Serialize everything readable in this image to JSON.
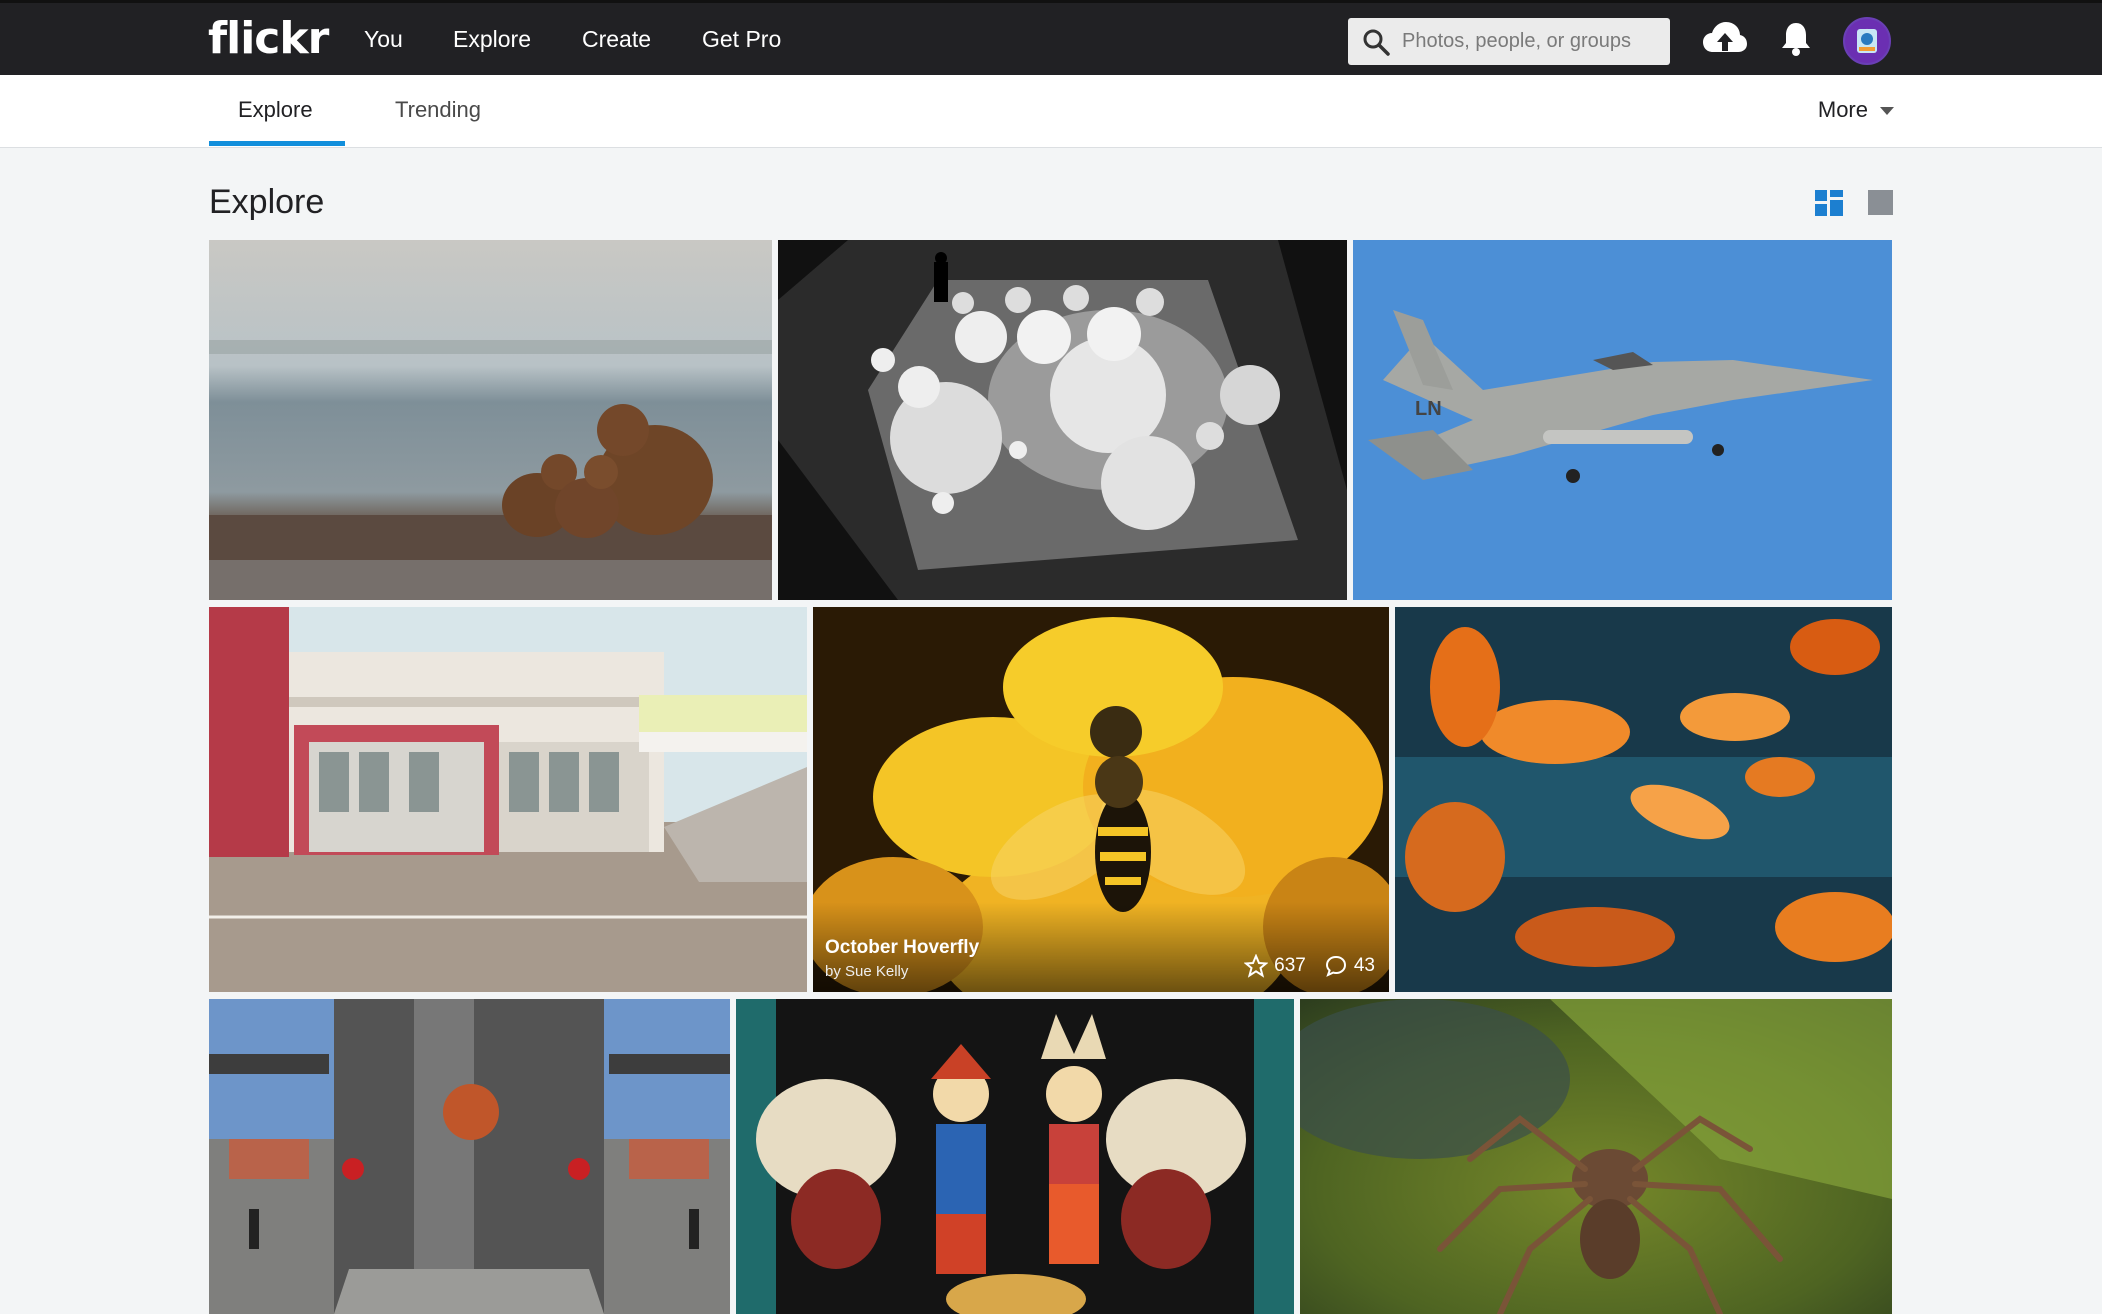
{
  "brand": {
    "logo": "flickr"
  },
  "topnav": {
    "items": [
      "You",
      "Explore",
      "Create",
      "Get Pro"
    ]
  },
  "search": {
    "placeholder": "Photos, people, or groups"
  },
  "icons": {
    "search": "search-icon",
    "upload": "cloud-upload-icon",
    "notifications": "bell-icon",
    "avatar": "user-avatar",
    "grid_view": "grid-view-icon",
    "single_view": "single-view-icon"
  },
  "subnav": {
    "tabs": [
      "Explore",
      "Trending"
    ],
    "active": "Explore",
    "more_label": "More"
  },
  "page": {
    "title": "Explore"
  },
  "photos": [
    {
      "subject": "bears"
    },
    {
      "subject": "bw-tiles"
    },
    {
      "subject": "jet"
    },
    {
      "subject": "building"
    },
    {
      "subject": "hoverfly",
      "title": "October Hoverfly",
      "author": "by Sue Kelly",
      "faves": "637",
      "comments": "43"
    },
    {
      "subject": "goldfish"
    },
    {
      "subject": "street"
    },
    {
      "subject": "scarecrows"
    },
    {
      "subject": "spider"
    }
  ],
  "colors": {
    "topbar": "#212124",
    "accent": "#128fdc",
    "page_bg": "#f3f5f6"
  }
}
